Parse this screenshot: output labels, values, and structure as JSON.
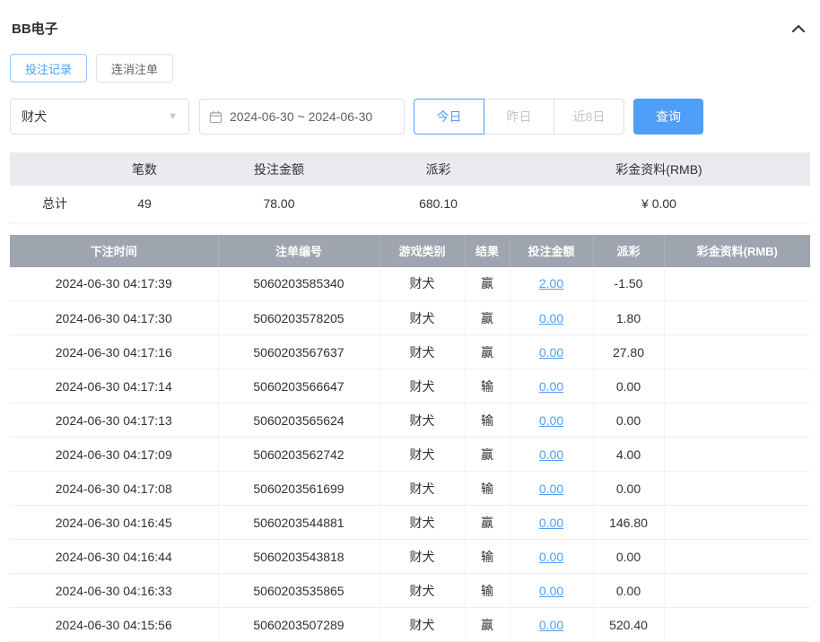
{
  "header": {
    "title": "BB电子"
  },
  "tabs": [
    {
      "label": "投注记录",
      "active": true
    },
    {
      "label": "连消注单",
      "active": false
    }
  ],
  "filters": {
    "game_select": {
      "value": "财犬"
    },
    "date_range": {
      "value": "2024-06-30 ~ 2024-06-30"
    },
    "quick_buttons": [
      {
        "label": "今日",
        "active": true
      },
      {
        "label": "昨日",
        "active": false
      },
      {
        "label": "近8日",
        "active": false
      }
    ],
    "search_label": "查询"
  },
  "summary": {
    "headers": [
      "笔数",
      "投注金额",
      "派彩",
      "彩金资料(RMB)"
    ],
    "row_label": "总计",
    "count": "49",
    "bet_amount": "78.00",
    "payout": "680.10",
    "bonus": "¥ 0.00"
  },
  "table": {
    "headers": [
      "下注时间",
      "注单编号",
      "游戏类别",
      "结果",
      "投注金额",
      "派彩",
      "彩金资料(RMB)"
    ],
    "rows": [
      {
        "time": "2024-06-30 04:17:39",
        "order_id": "5060203585340",
        "game": "财犬",
        "result": "赢",
        "bet": "2.00",
        "payout": "-1.50",
        "bonus": ""
      },
      {
        "time": "2024-06-30 04:17:30",
        "order_id": "5060203578205",
        "game": "财犬",
        "result": "赢",
        "bet": "0.00",
        "payout": "1.80",
        "bonus": ""
      },
      {
        "time": "2024-06-30 04:17:16",
        "order_id": "5060203567637",
        "game": "财犬",
        "result": "赢",
        "bet": "0.00",
        "payout": "27.80",
        "bonus": ""
      },
      {
        "time": "2024-06-30 04:17:14",
        "order_id": "5060203566647",
        "game": "财犬",
        "result": "输",
        "bet": "0.00",
        "payout": "0.00",
        "bonus": ""
      },
      {
        "time": "2024-06-30 04:17:13",
        "order_id": "5060203565624",
        "game": "财犬",
        "result": "输",
        "bet": "0.00",
        "payout": "0.00",
        "bonus": ""
      },
      {
        "time": "2024-06-30 04:17:09",
        "order_id": "5060203562742",
        "game": "财犬",
        "result": "赢",
        "bet": "0.00",
        "payout": "4.00",
        "bonus": ""
      },
      {
        "time": "2024-06-30 04:17:08",
        "order_id": "5060203561699",
        "game": "财犬",
        "result": "输",
        "bet": "0.00",
        "payout": "0.00",
        "bonus": ""
      },
      {
        "time": "2024-06-30 04:16:45",
        "order_id": "5060203544881",
        "game": "财犬",
        "result": "赢",
        "bet": "0.00",
        "payout": "146.80",
        "bonus": ""
      },
      {
        "time": "2024-06-30 04:16:44",
        "order_id": "5060203543818",
        "game": "财犬",
        "result": "输",
        "bet": "0.00",
        "payout": "0.00",
        "bonus": ""
      },
      {
        "time": "2024-06-30 04:16:33",
        "order_id": "5060203535865",
        "game": "财犬",
        "result": "输",
        "bet": "0.00",
        "payout": "0.00",
        "bonus": ""
      },
      {
        "time": "2024-06-30 04:15:56",
        "order_id": "5060203507289",
        "game": "财犬",
        "result": "赢",
        "bet": "0.00",
        "payout": "520.40",
        "bonus": ""
      }
    ]
  },
  "colors": {
    "accent": "#4f9ef7",
    "negative": "#f25c5c",
    "table_header_bg": "#9fa5ae",
    "summary_header_bg": "#e9ebef"
  }
}
